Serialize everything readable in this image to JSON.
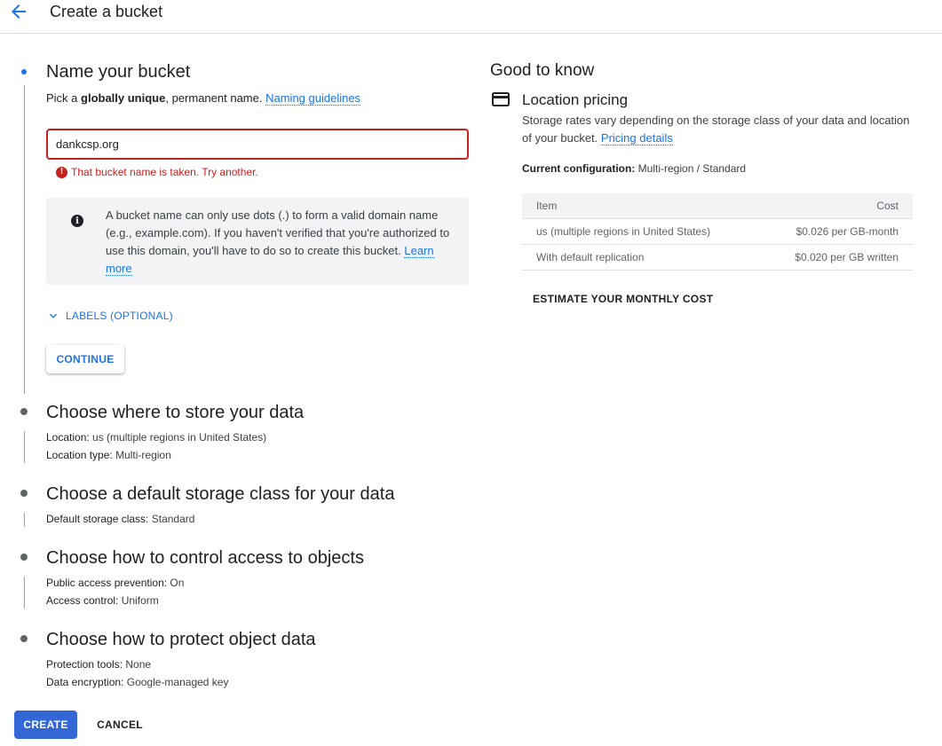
{
  "header": {
    "title": "Create a bucket",
    "back_icon": "arrow-back-icon"
  },
  "step_name": {
    "title": "Name your bucket",
    "subtitle_prefix": "Pick a ",
    "subtitle_bold": "globally unique",
    "subtitle_suffix": ", permanent name.",
    "naming_guidelines_link": "Naming guidelines",
    "input_value": "dankcsp.org",
    "error_text": "That bucket name is taken. Try another.",
    "info_text": "A bucket name can only use dots (.) to form a valid domain name (e.g., example.com). If you haven't verified that you're authorized to use this domain, you'll have to do so to create this bucket.",
    "info_link": "Learn more",
    "labels_toggle": "LABELS (OPTIONAL)",
    "continue_label": "CONTINUE"
  },
  "step_location": {
    "title": "Choose where to store your data",
    "location_key": "Location:",
    "location_value": "us (multiple regions in United States)",
    "type_key": "Location type:",
    "type_value": "Multi-region"
  },
  "step_storage_class": {
    "title": "Choose a default storage class for your data",
    "class_key": "Default storage class:",
    "class_value": "Standard"
  },
  "step_access": {
    "title": "Choose how to control access to objects",
    "prevention_key": "Public access prevention:",
    "prevention_value": "On",
    "control_key": "Access control:",
    "control_value": "Uniform"
  },
  "step_protect": {
    "title": "Choose how to protect object data",
    "tools_key": "Protection tools:",
    "tools_value": "None",
    "encryption_key": "Data encryption:",
    "encryption_value": "Google-managed key"
  },
  "actions": {
    "create_label": "CREATE",
    "cancel_label": "CANCEL"
  },
  "good_to_know": {
    "title": "Good to know",
    "pricing_title": "Location pricing",
    "pricing_desc": "Storage rates vary depending on the storage class of your data and location of your bucket.",
    "pricing_link": "Pricing details",
    "current_config_key": "Current configuration:",
    "current_config_value": "Multi-region / Standard",
    "table": {
      "headers": [
        "Item",
        "Cost"
      ],
      "rows": [
        [
          "us (multiple regions in United States)",
          "$0.026 per GB-month"
        ],
        [
          "With default replication",
          "$0.020 per GB written"
        ]
      ]
    },
    "estimate_label": "ESTIMATE YOUR MONTHLY COST"
  },
  "colors": {
    "accent": "#1a73e8",
    "error": "#c5221f",
    "primary_button": "#3367d6"
  }
}
